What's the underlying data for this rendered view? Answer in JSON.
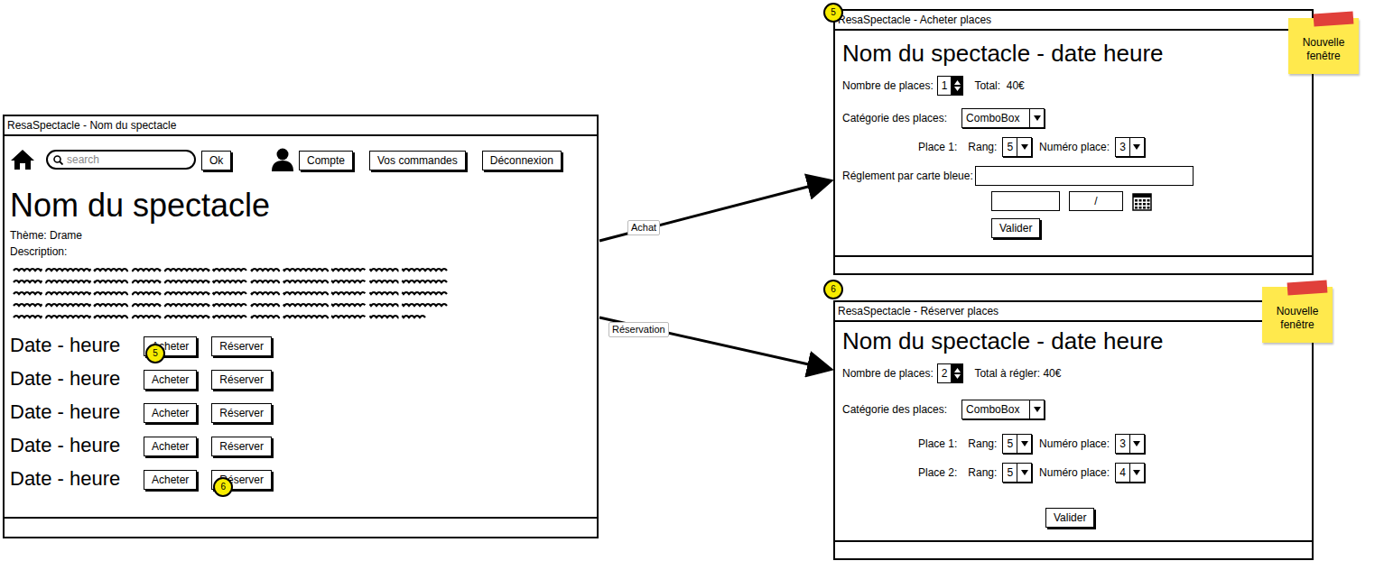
{
  "main_window": {
    "title": "ResaSpectacle - Nom du spectacle",
    "toolbar": {
      "search_placeholder": "search",
      "ok": "Ok",
      "account": "Compte",
      "orders": "Vos commandes",
      "logout": "Déconnexion"
    },
    "heading": "Nom du spectacle",
    "theme": "Thème: Drame",
    "description_label": "Description:",
    "showtimes": [
      {
        "label": "Date - heure",
        "buy": "Acheter",
        "reserve": "Réserver",
        "buy_badge": "5",
        "reserve_badge": ""
      },
      {
        "label": "Date - heure",
        "buy": "Acheter",
        "reserve": "Réserver",
        "buy_badge": "",
        "reserve_badge": ""
      },
      {
        "label": "Date - heure",
        "buy": "Acheter",
        "reserve": "Réserver",
        "buy_badge": "",
        "reserve_badge": ""
      },
      {
        "label": "Date - heure",
        "buy": "Acheter",
        "reserve": "Réserver",
        "buy_badge": "",
        "reserve_badge": ""
      },
      {
        "label": "Date - heure",
        "buy": "Acheter",
        "reserve": "Réserver",
        "buy_badge": "",
        "reserve_badge": "6"
      }
    ]
  },
  "arrows": [
    {
      "label": "Achat"
    },
    {
      "label": "Réservation"
    }
  ],
  "purchase_window": {
    "badge": "5",
    "title": "ResaSpectacle - Acheter places",
    "note": "Nouvelle fenêtre",
    "heading": "Nom du spectacle - date heure",
    "places_label": "Nombre de places:",
    "places": "1",
    "total": "Total:  40€",
    "category_label": "Catégorie des places:",
    "category": "ComboBox",
    "seats": [
      {
        "label": "Place 1:",
        "rank_label": "Rang:",
        "rank": "5",
        "seat_label": "Numéro place:",
        "seat": "3"
      }
    ],
    "card_label": "Réglement par carte bleue:",
    "card_number": "",
    "expiry_month": "",
    "expiry_year": "/",
    "submit": "Valider"
  },
  "reservation_window": {
    "badge": "6",
    "title": "ResaSpectacle - Réserver places",
    "note": "Nouvelle fenêtre",
    "heading": "Nom du spectacle - date heure",
    "places_label": "Nombre de places:",
    "places": "2",
    "total": "Total à régler: 40€",
    "category_label": "Catégorie des places:",
    "category": "ComboBox",
    "seats": [
      {
        "label": "Place 1:",
        "rank_label": "Rang:",
        "rank": "5",
        "seat_label": "Numéro place:",
        "seat": "3"
      },
      {
        "label": "Place 2:",
        "rank_label": "Rang:",
        "rank": "5",
        "seat_label": "Numéro place:",
        "seat": "4"
      }
    ],
    "submit": "Valider"
  }
}
